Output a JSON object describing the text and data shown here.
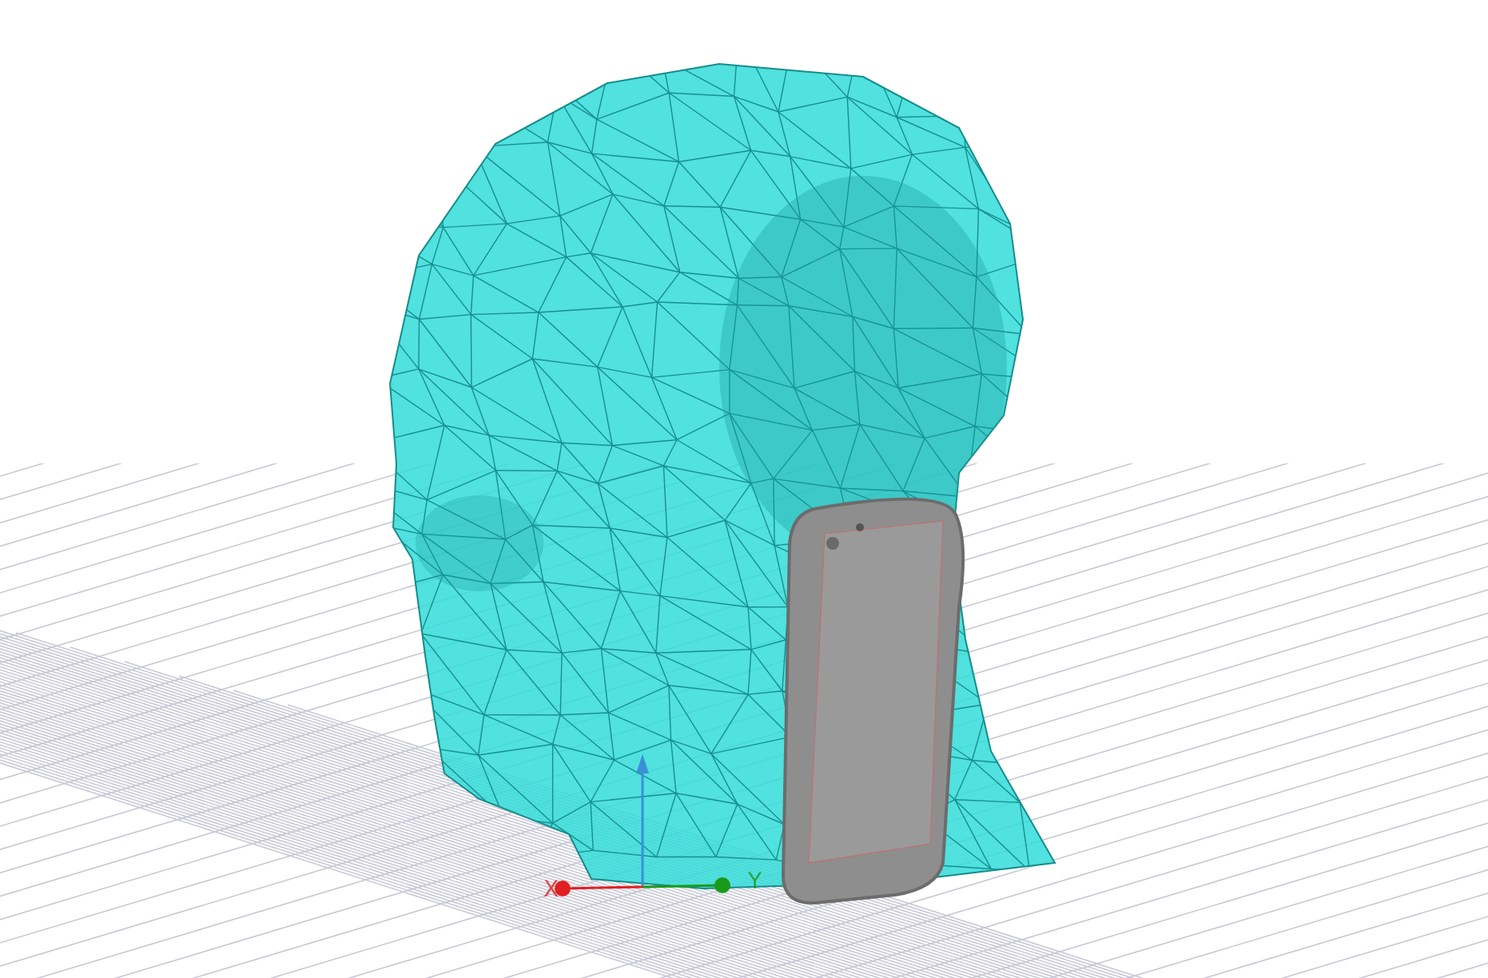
{
  "viewport": {
    "axes": [
      {
        "label": "X",
        "color": "#e02020"
      },
      {
        "label": "Y",
        "color": "#1a9a1a"
      }
    ]
  }
}
